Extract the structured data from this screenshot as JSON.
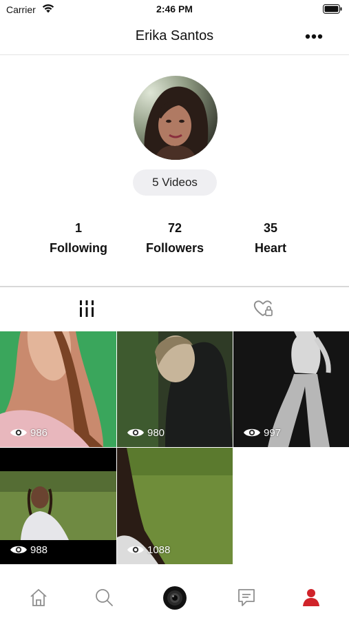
{
  "status_bar": {
    "carrier": "Carrier",
    "time": "2:46 PM"
  },
  "header": {
    "title": "Erika Santos",
    "more_icon": "ellipsis-icon"
  },
  "profile": {
    "videos_label": "5 Videos",
    "stats": [
      {
        "value": "1",
        "label": "Following"
      },
      {
        "value": "72",
        "label": "Followers"
      },
      {
        "value": "35",
        "label": "Heart"
      }
    ]
  },
  "content_tabs": [
    {
      "icon": "grid-bars-icon",
      "active": true
    },
    {
      "icon": "liked-heart-lock-icon",
      "active": false
    }
  ],
  "videos": [
    {
      "views": "986"
    },
    {
      "views": "980"
    },
    {
      "views": "997"
    },
    {
      "views": "988"
    },
    {
      "views": "1088"
    }
  ],
  "tab_bar": [
    {
      "icon": "home-icon"
    },
    {
      "icon": "search-icon"
    },
    {
      "icon": "camera-record-icon"
    },
    {
      "icon": "messages-icon"
    },
    {
      "icon": "profile-icon",
      "active": true
    }
  ],
  "colors": {
    "accent": "#d0232a",
    "inactive_icon": "#8e8e8e",
    "divider": "#d8d8d8"
  }
}
